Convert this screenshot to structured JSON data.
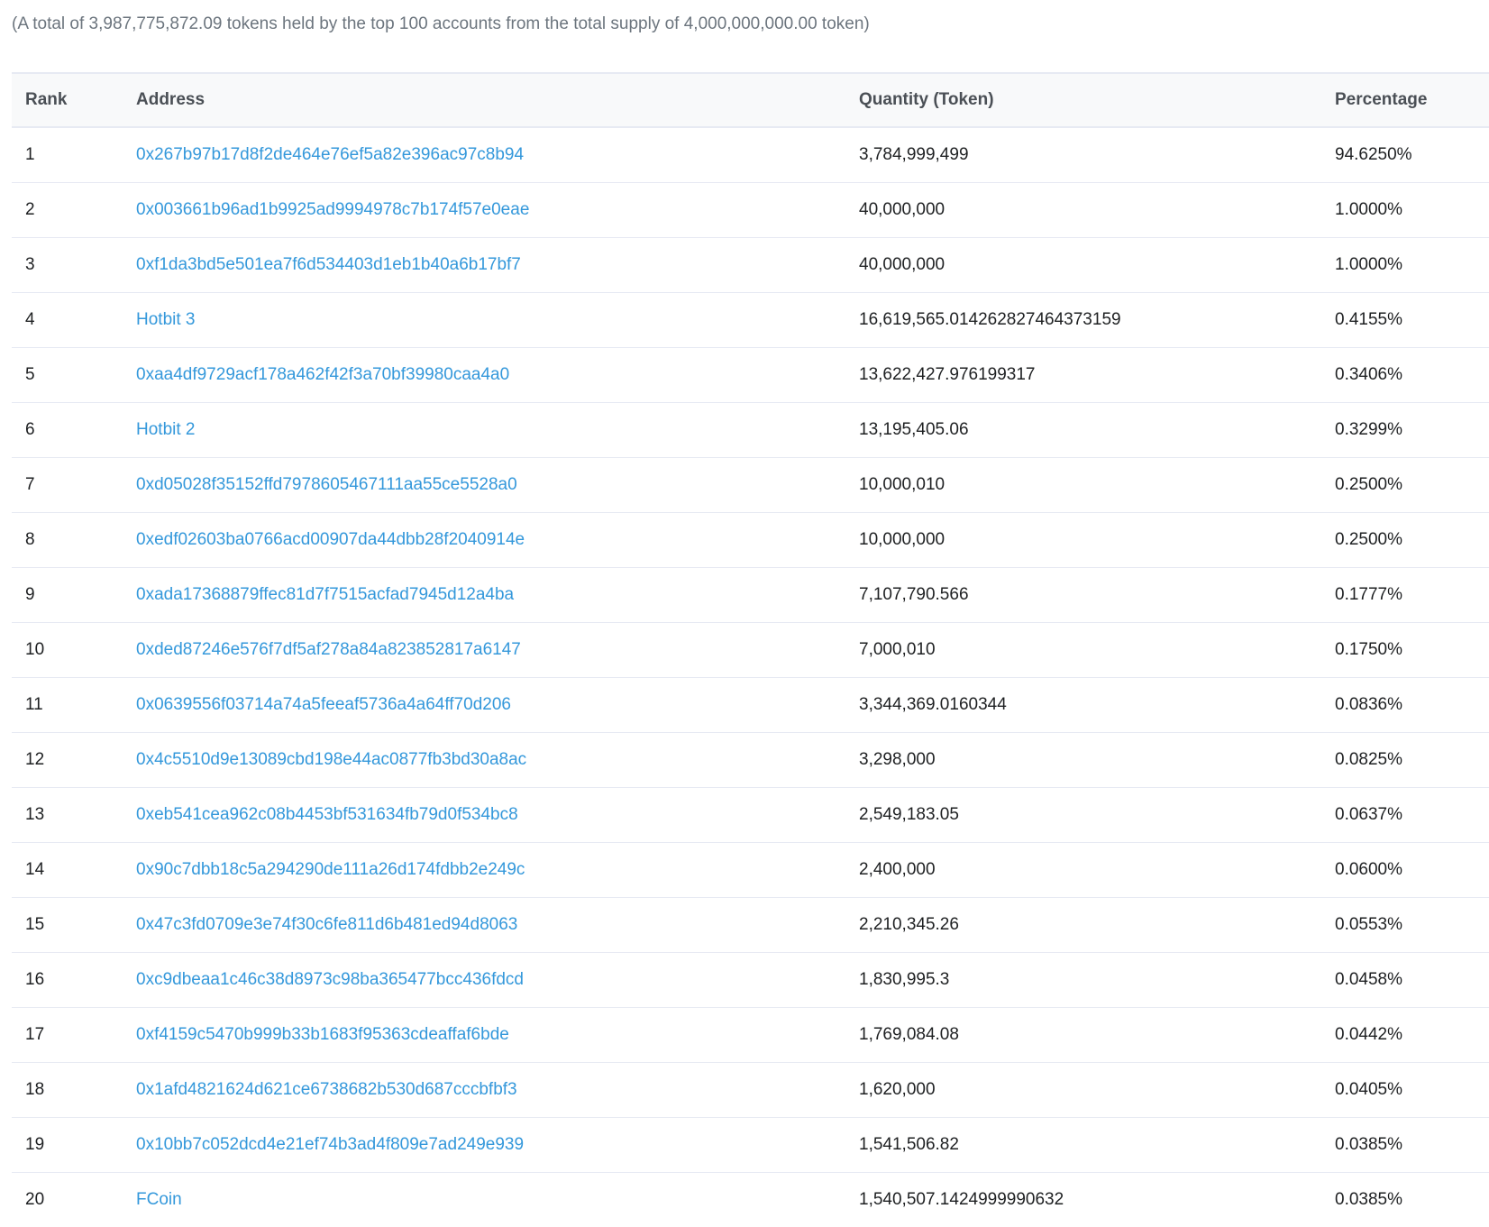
{
  "summary": "(A total of 3,987,775,872.09 tokens held by the top 100 accounts from the total supply of 4,000,000,000.00 token)",
  "table": {
    "headers": {
      "rank": "Rank",
      "address": "Address",
      "quantity": "Quantity (Token)",
      "percentage": "Percentage"
    },
    "rows": [
      {
        "rank": "1",
        "address": "0x267b97b17d8f2de464e76ef5a82e396ac97c8b94",
        "quantity": "3,784,999,499",
        "percentage": "94.6250%"
      },
      {
        "rank": "2",
        "address": "0x003661b96ad1b9925ad9994978c7b174f57e0eae",
        "quantity": "40,000,000",
        "percentage": "1.0000%"
      },
      {
        "rank": "3",
        "address": "0xf1da3bd5e501ea7f6d534403d1eb1b40a6b17bf7",
        "quantity": "40,000,000",
        "percentage": "1.0000%"
      },
      {
        "rank": "4",
        "address": "Hotbit 3",
        "quantity": "16,619,565.014262827464373159",
        "percentage": "0.4155%"
      },
      {
        "rank": "5",
        "address": "0xaa4df9729acf178a462f42f3a70bf39980caa4a0",
        "quantity": "13,622,427.976199317",
        "percentage": "0.3406%"
      },
      {
        "rank": "6",
        "address": "Hotbit 2",
        "quantity": "13,195,405.06",
        "percentage": "0.3299%"
      },
      {
        "rank": "7",
        "address": "0xd05028f35152ffd7978605467111aa55ce5528a0",
        "quantity": "10,000,010",
        "percentage": "0.2500%"
      },
      {
        "rank": "8",
        "address": "0xedf02603ba0766acd00907da44dbb28f2040914e",
        "quantity": "10,000,000",
        "percentage": "0.2500%"
      },
      {
        "rank": "9",
        "address": "0xada17368879ffec81d7f7515acfad7945d12a4ba",
        "quantity": "7,107,790.566",
        "percentage": "0.1777%"
      },
      {
        "rank": "10",
        "address": "0xded87246e576f7df5af278a84a823852817a6147",
        "quantity": "7,000,010",
        "percentage": "0.1750%"
      },
      {
        "rank": "11",
        "address": "0x0639556f03714a74a5feeaf5736a4a64ff70d206",
        "quantity": "3,344,369.0160344",
        "percentage": "0.0836%"
      },
      {
        "rank": "12",
        "address": "0x4c5510d9e13089cbd198e44ac0877fb3bd30a8ac",
        "quantity": "3,298,000",
        "percentage": "0.0825%"
      },
      {
        "rank": "13",
        "address": "0xeb541cea962c08b4453bf531634fb79d0f534bc8",
        "quantity": "2,549,183.05",
        "percentage": "0.0637%"
      },
      {
        "rank": "14",
        "address": "0x90c7dbb18c5a294290de111a26d174fdbb2e249c",
        "quantity": "2,400,000",
        "percentage": "0.0600%"
      },
      {
        "rank": "15",
        "address": "0x47c3fd0709e3e74f30c6fe811d6b481ed94d8063",
        "quantity": "2,210,345.26",
        "percentage": "0.0553%"
      },
      {
        "rank": "16",
        "address": "0xc9dbeaa1c46c38d8973c98ba365477bcc436fdcd",
        "quantity": "1,830,995.3",
        "percentage": "0.0458%"
      },
      {
        "rank": "17",
        "address": "0xf4159c5470b999b33b1683f95363cdeaffaf6bde",
        "quantity": "1,769,084.08",
        "percentage": "0.0442%"
      },
      {
        "rank": "18",
        "address": "0x1afd4821624d621ce6738682b530d687cccbfbf3",
        "quantity": "1,620,000",
        "percentage": "0.0405%"
      },
      {
        "rank": "19",
        "address": "0x10bb7c052dcd4e21ef74b3ad4f809e7ad249e939",
        "quantity": "1,541,506.82",
        "percentage": "0.0385%"
      },
      {
        "rank": "20",
        "address": "FCoin",
        "quantity": "1,540,507.1424999990632",
        "percentage": "0.0385%"
      }
    ]
  },
  "colors": {
    "link": "#3498db",
    "summary_text": "#6c757e",
    "header_bg": "#f8f9fa",
    "border": "#e7eaf3"
  }
}
